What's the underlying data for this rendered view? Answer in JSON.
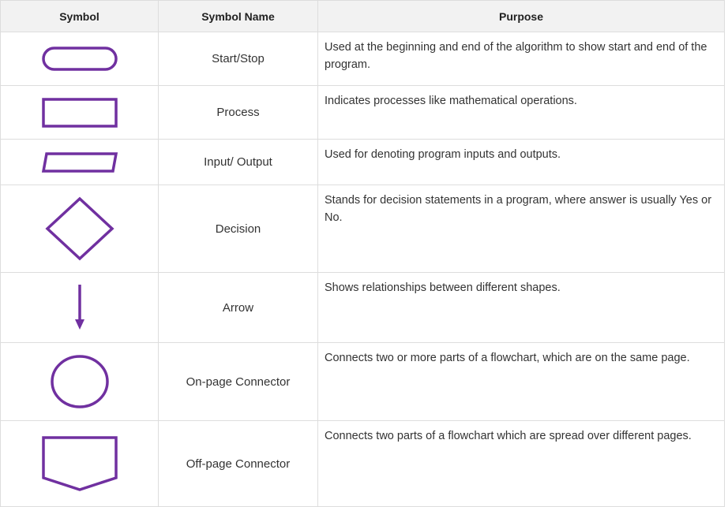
{
  "table": {
    "headers": {
      "symbol": "Symbol",
      "name": "Symbol Name",
      "purpose": "Purpose"
    },
    "rows": [
      {
        "symbol_icon": "rounded-rectangle-icon",
        "name": "Start/Stop",
        "purpose": "Used at the beginning and end of the algorithm to show start and end of the program."
      },
      {
        "symbol_icon": "rectangle-icon",
        "name": "Process",
        "purpose": "Indicates processes like mathematical operations."
      },
      {
        "symbol_icon": "parallelogram-icon",
        "name": "Input/ Output",
        "purpose": "Used for denoting program inputs and outputs."
      },
      {
        "symbol_icon": "diamond-icon",
        "name": "Decision",
        "purpose": "Stands for decision statements in a program, where answer is usually Yes or No."
      },
      {
        "symbol_icon": "arrow-down-icon",
        "name": "Arrow",
        "purpose": "Shows relationships between different shapes."
      },
      {
        "symbol_icon": "circle-icon",
        "name": "On-page Connector",
        "purpose": "Connects two or more parts of a flowchart, which are on the same page."
      },
      {
        "symbol_icon": "pentagon-connector-icon",
        "name": "Off-page Connector",
        "purpose": "Connects two parts of a flowchart which are spread over different pages."
      }
    ]
  },
  "colors": {
    "symbol_stroke": "#7030a0",
    "header_background": "#f2f2f2",
    "border": "#dddddd"
  }
}
